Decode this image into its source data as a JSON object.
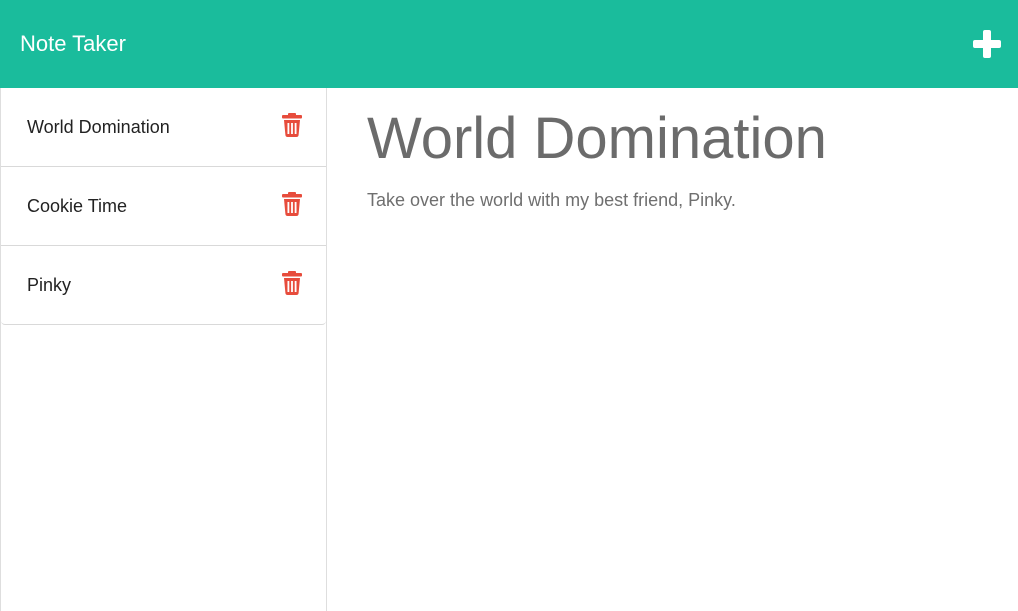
{
  "header": {
    "title": "Note Taker",
    "add_icon": "plus-icon"
  },
  "sidebar": {
    "items": [
      {
        "label": "World Domination",
        "delete_icon": "trash-icon"
      },
      {
        "label": "Cookie Time",
        "delete_icon": "trash-icon"
      },
      {
        "label": "Pinky",
        "delete_icon": "trash-icon"
      }
    ]
  },
  "main": {
    "note_title": "World Domination",
    "note_text": "Take over the world with my best friend, Pinky."
  },
  "colors": {
    "accent": "#1abc9c",
    "danger": "#e74c3c",
    "heading_text": "#6b6b6b"
  }
}
